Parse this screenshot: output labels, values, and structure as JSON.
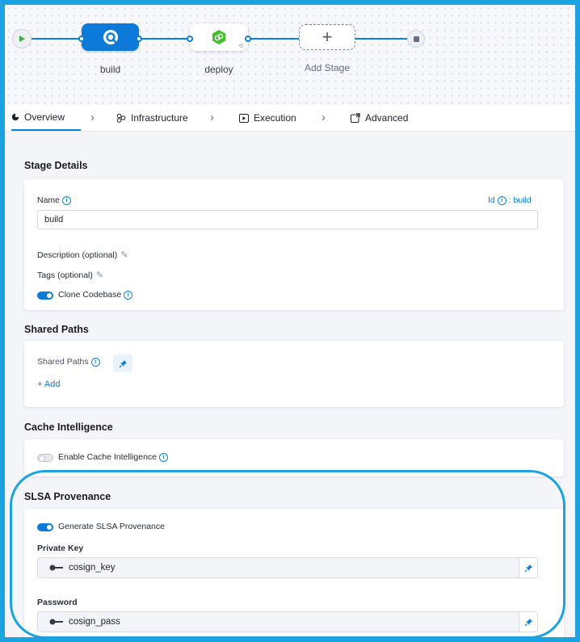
{
  "pipeline": {
    "stages": [
      {
        "name": "build",
        "icon": "build-stage-icon",
        "active": true
      },
      {
        "name": "deploy",
        "icon": "deploy-stage-icon",
        "active": false
      }
    ],
    "add_stage_label": "Add Stage",
    "add_symbol": "+"
  },
  "tabs": [
    {
      "label": "Overview",
      "active": true
    },
    {
      "label": "Infrastructure",
      "active": false
    },
    {
      "label": "Execution",
      "active": false
    },
    {
      "label": "Advanced",
      "active": false
    }
  ],
  "stage_details": {
    "title": "Stage Details",
    "name_label": "Name",
    "id_label": "Id",
    "id_value": ": build",
    "name_value": "build",
    "description_label": "Description (optional)",
    "tags_label": "Tags (optional)",
    "clone_codebase_label": "Clone Codebase",
    "clone_codebase_on": true
  },
  "shared_paths": {
    "title": "Shared Paths",
    "label": "Shared Paths",
    "add_label": "+ Add"
  },
  "cache_intelligence": {
    "title": "Cache Intelligence",
    "toggle_label": "Enable Cache Intelligence",
    "enabled": false
  },
  "slsa": {
    "title": "SLSA Provenance",
    "toggle_label": "Generate SLSA Provenance",
    "enabled": true,
    "private_key_label": "Private Key",
    "private_key_value": "cosign_key",
    "password_label": "Password",
    "password_value": "cosign_pass"
  },
  "colors": {
    "accent": "#0b7ad8",
    "highlight": "#1aa3e0"
  }
}
